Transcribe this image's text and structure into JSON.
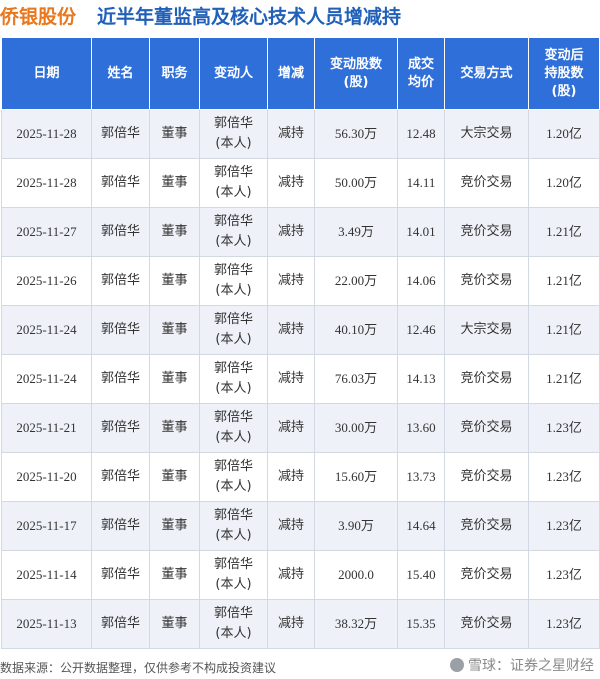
{
  "header": {
    "company": "侨银股份",
    "title": "近半年董监高及核心技术人员增减持"
  },
  "table": {
    "columns": [
      "日期",
      "姓名",
      "职务",
      "变动人",
      "增减",
      "变动股数\n(股)",
      "成交\n均价",
      "交易方式",
      "变动后\n持股数\n(股)"
    ],
    "rows": [
      {
        "date": "2025-11-28",
        "name": "郭倍华",
        "role": "董事",
        "person": "郭倍华\n(本人)",
        "change": "减持",
        "shares": "56.30万",
        "price": "12.48",
        "method": "大宗交易",
        "after": "1.20亿"
      },
      {
        "date": "2025-11-28",
        "name": "郭倍华",
        "role": "董事",
        "person": "郭倍华\n(本人)",
        "change": "减持",
        "shares": "50.00万",
        "price": "14.11",
        "method": "竞价交易",
        "after": "1.20亿"
      },
      {
        "date": "2025-11-27",
        "name": "郭倍华",
        "role": "董事",
        "person": "郭倍华\n(本人)",
        "change": "减持",
        "shares": "3.49万",
        "price": "14.01",
        "method": "竞价交易",
        "after": "1.21亿"
      },
      {
        "date": "2025-11-26",
        "name": "郭倍华",
        "role": "董事",
        "person": "郭倍华\n(本人)",
        "change": "减持",
        "shares": "22.00万",
        "price": "14.06",
        "method": "竞价交易",
        "after": "1.21亿"
      },
      {
        "date": "2025-11-24",
        "name": "郭倍华",
        "role": "董事",
        "person": "郭倍华\n(本人)",
        "change": "减持",
        "shares": "40.10万",
        "price": "12.46",
        "method": "大宗交易",
        "after": "1.21亿"
      },
      {
        "date": "2025-11-24",
        "name": "郭倍华",
        "role": "董事",
        "person": "郭倍华\n(本人)",
        "change": "减持",
        "shares": "76.03万",
        "price": "14.13",
        "method": "竞价交易",
        "after": "1.21亿"
      },
      {
        "date": "2025-11-21",
        "name": "郭倍华",
        "role": "董事",
        "person": "郭倍华\n(本人)",
        "change": "减持",
        "shares": "30.00万",
        "price": "13.60",
        "method": "竞价交易",
        "after": "1.23亿"
      },
      {
        "date": "2025-11-20",
        "name": "郭倍华",
        "role": "董事",
        "person": "郭倍华\n(本人)",
        "change": "减持",
        "shares": "15.60万",
        "price": "13.73",
        "method": "竞价交易",
        "after": "1.23亿"
      },
      {
        "date": "2025-11-17",
        "name": "郭倍华",
        "role": "董事",
        "person": "郭倍华\n(本人)",
        "change": "减持",
        "shares": "3.90万",
        "price": "14.64",
        "method": "竞价交易",
        "after": "1.23亿"
      },
      {
        "date": "2025-11-14",
        "name": "郭倍华",
        "role": "董事",
        "person": "郭倍华\n(本人)",
        "change": "减持",
        "shares": "2000.0",
        "price": "15.40",
        "method": "竞价交易",
        "after": "1.23亿"
      },
      {
        "date": "2025-11-13",
        "name": "郭倍华",
        "role": "董事",
        "person": "郭倍华\n(本人)",
        "change": "减持",
        "shares": "38.32万",
        "price": "15.35",
        "method": "竞价交易",
        "after": "1.23亿"
      }
    ]
  },
  "footer": {
    "source": "数据来源：公开数据整理，仅供参考不构成投资建议",
    "brand": "雪球：证券之星财经"
  },
  "colors": {
    "company": "#e8771e",
    "title": "#2160b8",
    "header_bg": "#2f6fd9",
    "change_text": "#1a9a3a",
    "row_alt": "#eef2f8"
  }
}
